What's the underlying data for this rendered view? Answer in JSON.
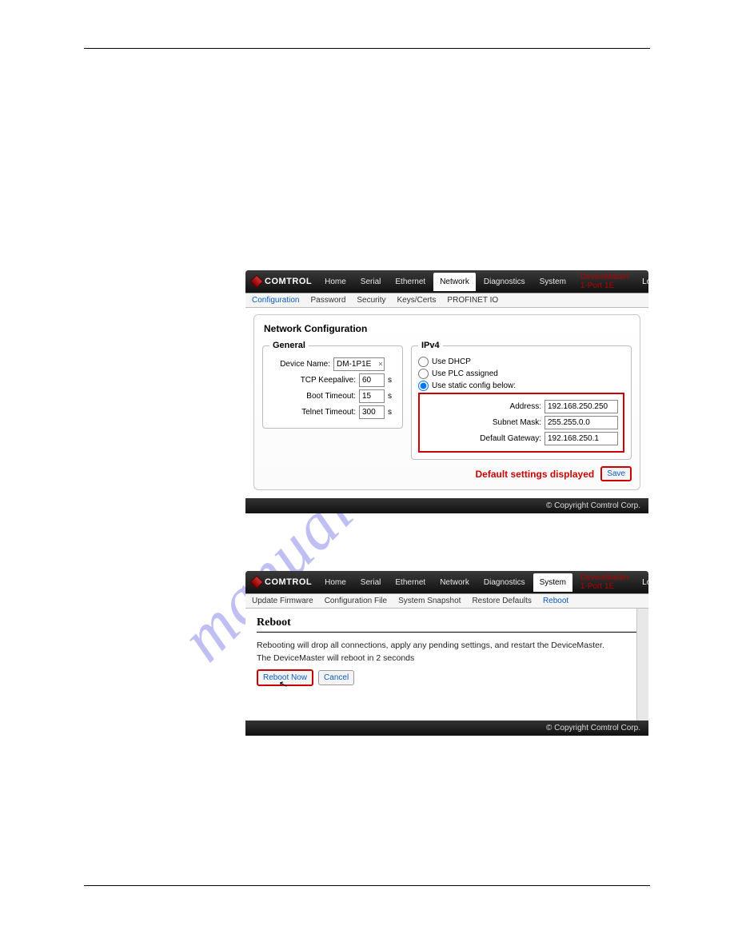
{
  "brand": "Comtrol",
  "device_header": "DeviceMaster 1-Port 1E",
  "logout": "Logout",
  "watermark": "manualshive.com",
  "screenshot1": {
    "nav": {
      "home": "Home",
      "serial": "Serial",
      "ethernet": "Ethernet",
      "network": "Network",
      "diagnostics": "Diagnostics",
      "system": "System"
    },
    "subnav": {
      "configuration": "Configuration",
      "password": "Password",
      "security": "Security",
      "keys": "Keys/Certs",
      "profinet": "PROFINET IO"
    },
    "title": "Network Configuration",
    "general": {
      "legend": "General",
      "device_name_label": "Device Name:",
      "device_name_value": "DM-1P1E",
      "tcp_keep_label": "TCP Keepalive:",
      "tcp_keep_value": "60",
      "boot_timeout_label": "Boot Timeout:",
      "boot_timeout_value": "15",
      "telnet_timeout_label": "Telnet Timeout:",
      "telnet_timeout_value": "300",
      "seconds": "s"
    },
    "ipv4": {
      "legend": "IPv4",
      "use_dhcp": "Use DHCP",
      "use_plc": "Use PLC assigned",
      "use_static": "Use static config below:",
      "address_label": "Address:",
      "address_value": "192.168.250.250",
      "subnet_label": "Subnet Mask:",
      "subnet_value": "255.255.0.0",
      "gateway_label": "Default Gateway:",
      "gateway_value": "192.168.250.1"
    },
    "default_note": "Default settings displayed",
    "save": "Save",
    "footer": "© Copyright Comtrol Corp."
  },
  "screenshot2": {
    "nav": {
      "home": "Home",
      "serial": "Serial",
      "ethernet": "Ethernet",
      "network": "Network",
      "diagnostics": "Diagnostics",
      "system": "System"
    },
    "subnav": {
      "update": "Update Firmware",
      "config_file": "Configuration File",
      "snapshot": "System Snapshot",
      "restore": "Restore Defaults",
      "reboot": "Reboot"
    },
    "title": "Reboot",
    "p1": "Rebooting will drop all connections, apply any pending settings, and restart the DeviceMaster.",
    "p2": "The DeviceMaster will reboot in 2 seconds",
    "reboot_now": "Reboot Now",
    "cancel": "Cancel",
    "footer": "© Copyright Comtrol Corp."
  }
}
